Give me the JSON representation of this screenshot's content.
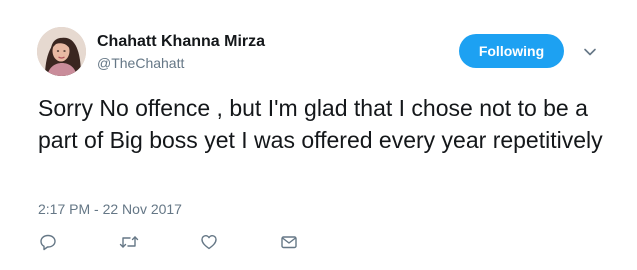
{
  "user": {
    "display_name": "Chahatt Khanna Mirza",
    "handle": "@TheChahatt",
    "avatar_icon": "profile-photo"
  },
  "follow_button": {
    "label": "Following",
    "color": "#1da1f2"
  },
  "menu": {
    "icon": "chevron-down-icon"
  },
  "tweet": {
    "text": "Sorry No offence , but I'm glad that I chose not to be a part of Big boss yet I was offered every year repetitively",
    "timestamp": "2:17 PM - 22 Nov 2017"
  },
  "actions": [
    {
      "name": "reply",
      "icon": "reply-icon"
    },
    {
      "name": "retweet",
      "icon": "retweet-icon"
    },
    {
      "name": "like",
      "icon": "heart-icon"
    },
    {
      "name": "direct-message",
      "icon": "envelope-icon"
    }
  ],
  "colors": {
    "text": "#14171a",
    "secondary": "#657786",
    "accent": "#1da1f2"
  }
}
